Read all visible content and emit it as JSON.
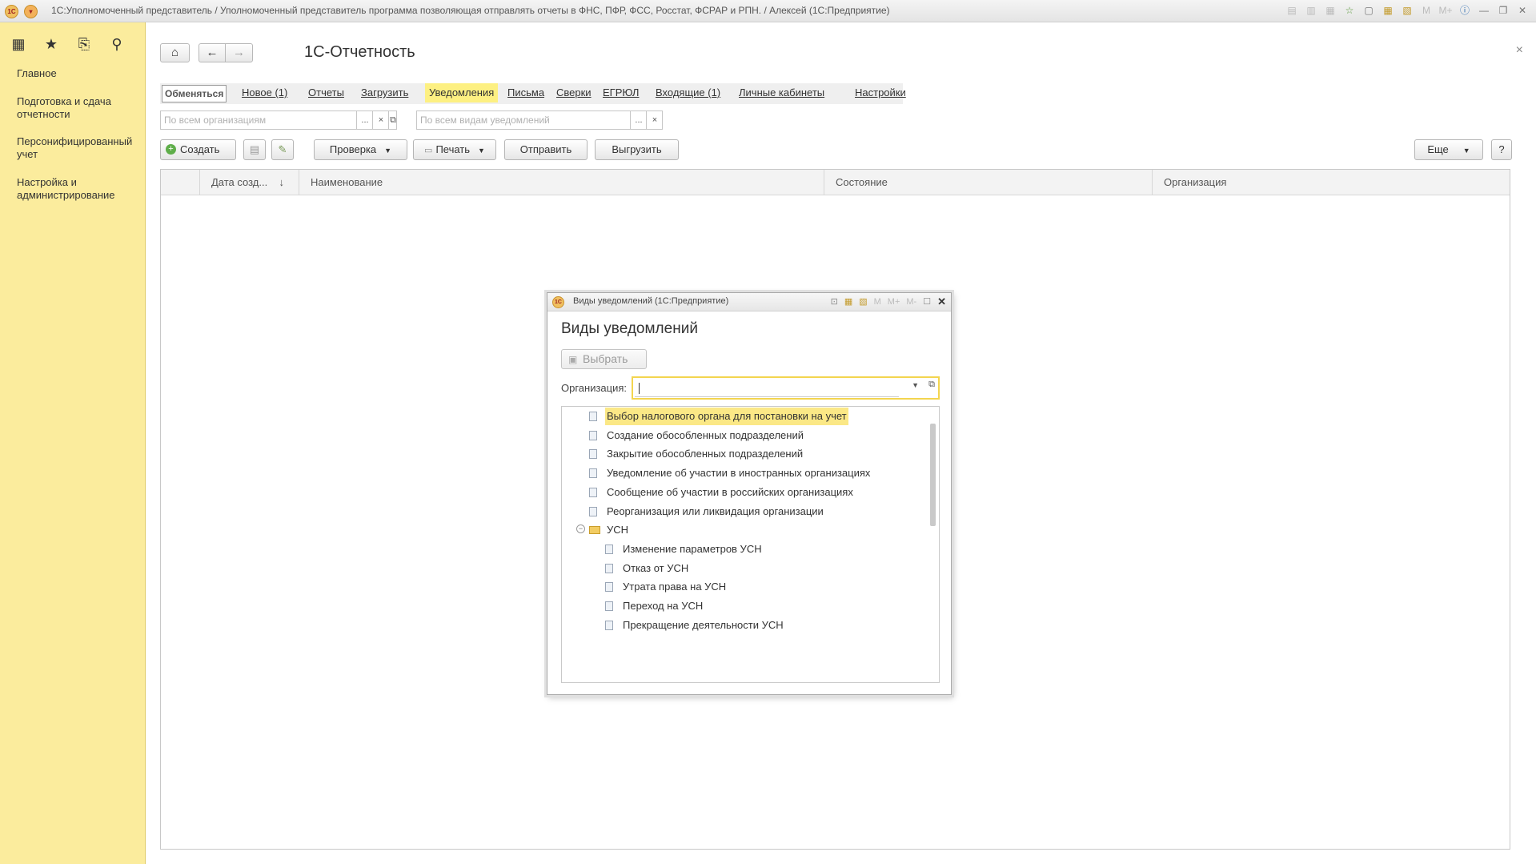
{
  "window": {
    "title": "1С:Уполномоченный представитель / Уполномоченный представитель программа позволяющая отправлять отчеты в ФНС, ПФР, ФСС, Росстат, ФСРАР и РПН. / Алексей  (1С:Предприятие)"
  },
  "sidebar": {
    "items": [
      {
        "label": "Главное"
      },
      {
        "label": "Подготовка и сдача отчетности"
      },
      {
        "label": "Персонифицированный учет"
      },
      {
        "label": "Настройка и администрирование"
      }
    ]
  },
  "main": {
    "title": "1С-Отчетность",
    "close_label": "×",
    "tabs": [
      {
        "label": "Обменяться"
      },
      {
        "label": "Новое (1)"
      },
      {
        "label": "Отчеты"
      },
      {
        "label": "Загрузить"
      },
      {
        "label": "Уведомления"
      },
      {
        "label": "Письма"
      },
      {
        "label": "Сверки"
      },
      {
        "label": "ЕГРЮЛ"
      },
      {
        "label": "Входящие (1)"
      },
      {
        "label": "Личные кабинеты"
      },
      {
        "label": "Настройки"
      }
    ],
    "active_tab": "Уведомления",
    "filters": {
      "org_placeholder": "По всем организациям",
      "kind_placeholder": "По всем видам уведомлений",
      "select_label": "...",
      "clear_label": "×"
    },
    "toolbar": {
      "create": "Создать",
      "check": "Проверка",
      "print": "Печать",
      "send": "Отправить",
      "export": "Выгрузить",
      "more": "Еще",
      "help": "?"
    },
    "table": {
      "columns": [
        "Дата созд...",
        "Наименование",
        "Состояние",
        "Организация"
      ],
      "sort_indicator": "↓"
    }
  },
  "dialog": {
    "window_title": "Виды уведомлений  (1С:Предприятие)",
    "heading": "Виды уведомлений",
    "choose_button": "Выбрать",
    "org_label": "Организация:",
    "tools": {
      "m": "M",
      "m_plus": "M+",
      "m_minus": "M-"
    },
    "items": [
      {
        "label": "Выбор налогового органа для постановки на учет",
        "type": "doc",
        "level": 0,
        "selected": true
      },
      {
        "label": "Создание обособленных подразделений",
        "type": "doc",
        "level": 0
      },
      {
        "label": "Закрытие обособленных подразделений",
        "type": "doc",
        "level": 0
      },
      {
        "label": "Уведомление об участии в иностранных организациях",
        "type": "doc",
        "level": 0
      },
      {
        "label": "Сообщение об участии в российских организациях",
        "type": "doc",
        "level": 0
      },
      {
        "label": "Реорганизация или ликвидация организации",
        "type": "doc",
        "level": 0
      },
      {
        "label": "УСН",
        "type": "folder",
        "level": 0,
        "expanded": true
      },
      {
        "label": "Изменение параметров УСН",
        "type": "doc",
        "level": 1
      },
      {
        "label": "Отказ от УСН",
        "type": "doc",
        "level": 1
      },
      {
        "label": "Утрата права на УСН",
        "type": "doc",
        "level": 1
      },
      {
        "label": "Переход на УСН",
        "type": "doc",
        "level": 1
      },
      {
        "label": "Прекращение деятельности УСН",
        "type": "doc",
        "level": 1
      }
    ]
  },
  "colors": {
    "sidebar_bg": "#fbec9d",
    "active_tab_bg": "#fdf082",
    "selection_bg": "#fbe886",
    "focus_border": "#f3d54f"
  }
}
